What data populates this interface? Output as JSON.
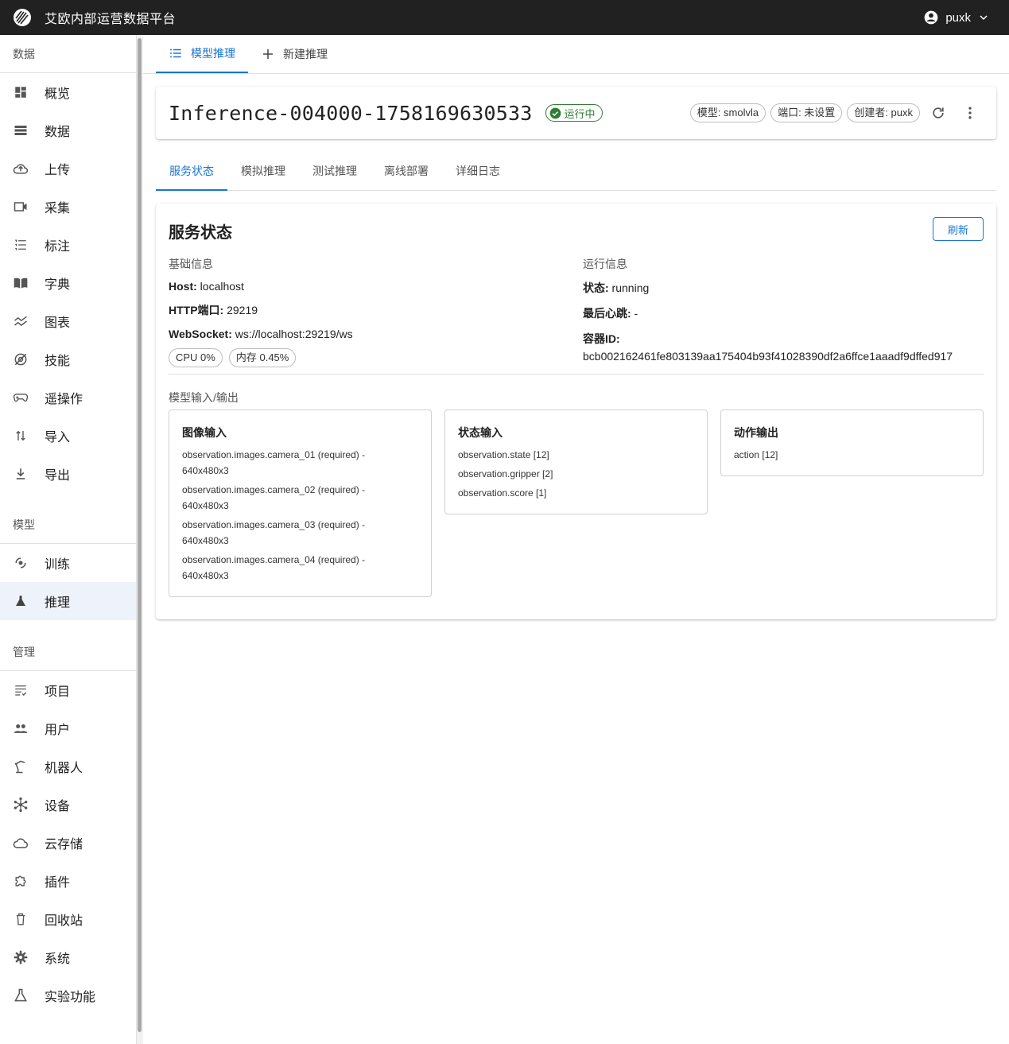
{
  "app": {
    "title": "艾欧内部运营数据平台",
    "user": "puxk"
  },
  "sidebar": {
    "sections": [
      {
        "title": "数据",
        "items": [
          "概览",
          "数据",
          "上传",
          "采集",
          "标注",
          "字典",
          "图表",
          "技能",
          "遥操作",
          "导入",
          "导出"
        ]
      },
      {
        "title": "模型",
        "items": [
          "训练",
          "推理"
        ]
      },
      {
        "title": "管理",
        "items": [
          "项目",
          "用户",
          "机器人",
          "设备",
          "云存储",
          "插件",
          "回收站",
          "系统",
          "实验功能"
        ]
      }
    ],
    "active": "推理"
  },
  "top_tabs": {
    "list": "模型推理",
    "new": "新建推理"
  },
  "header": {
    "title": "Inference-004000-1758169630533",
    "status": "运行中",
    "chips": {
      "model": "模型: smolvla",
      "port": "端口: 未设置",
      "creator": "创建者: puxk"
    }
  },
  "sub_tabs": [
    "服务状态",
    "模拟推理",
    "测试推理",
    "离线部署",
    "详细日志"
  ],
  "status_card": {
    "title": "服务状态",
    "refresh": "刷新",
    "basic": {
      "label": "基础信息",
      "host_k": "Host:",
      "host_v": " localhost",
      "http_k": "HTTP端口:",
      "http_v": " 29219",
      "ws_k": "WebSocket:",
      "ws_v": " ws://localhost:29219/ws",
      "cpu": "CPU 0%",
      "mem": "内存 0.45%"
    },
    "runtime": {
      "label": "运行信息",
      "state_k": "状态:",
      "state_v": " running",
      "hb_k": "最后心跳:",
      "hb_v": " -",
      "cid_k": "容器ID:",
      "cid_v": "bcb002162461fe803139aa175404b93f41028390df2a6ffce1aaadf9dffed917"
    },
    "io": {
      "label": "模型输入/输出",
      "image": {
        "title": "图像输入",
        "lines": [
          "observation.images.camera_01 (required) -",
          "640x480x3",
          "observation.images.camera_02 (required) -",
          "640x480x3",
          "observation.images.camera_03 (required) -",
          "640x480x3",
          "observation.images.camera_04 (required) -",
          "640x480x3"
        ]
      },
      "state": {
        "title": "状态输入",
        "lines": [
          "observation.state [12]",
          "observation.gripper [2]",
          "observation.score [1]"
        ]
      },
      "action": {
        "title": "动作输出",
        "lines": [
          "action [12]"
        ]
      }
    }
  }
}
